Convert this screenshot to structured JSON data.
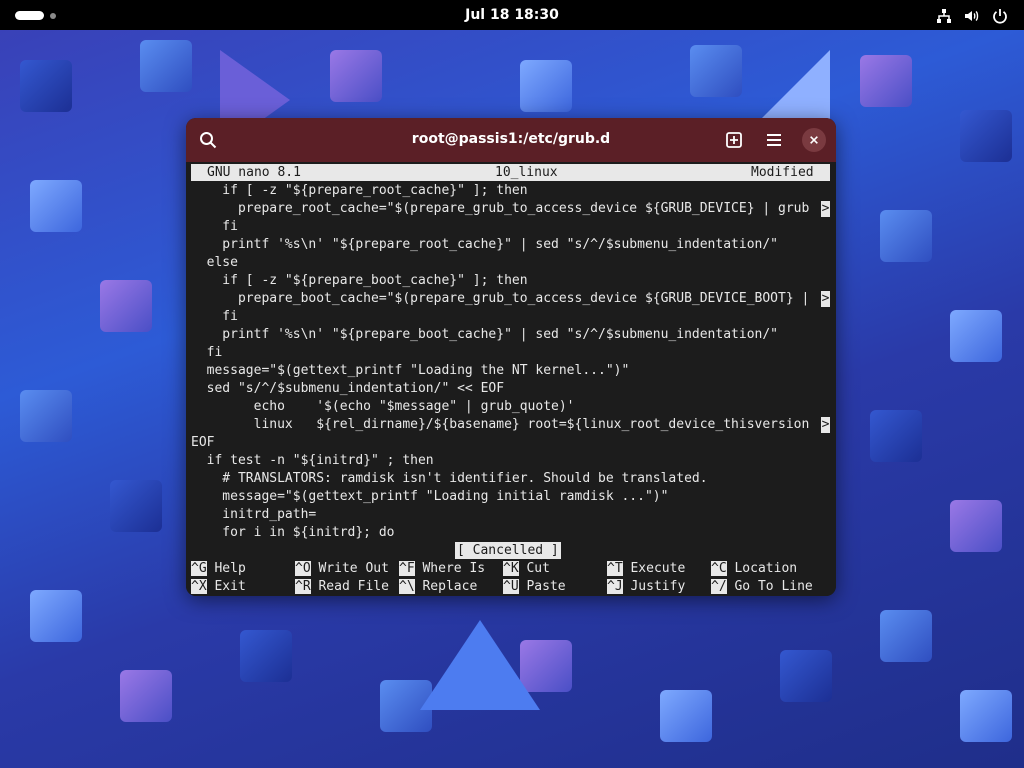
{
  "topbar": {
    "clock": "Jul 18  18:30",
    "icons": [
      "activities-pill",
      "network-icon",
      "volume-icon",
      "power-icon"
    ]
  },
  "window": {
    "title": "root@passis1:/etc/grub.d",
    "buttons": [
      "search-icon",
      "new-tab-icon",
      "menu-icon",
      "close-icon"
    ],
    "titlebar_color": "#5b1f26"
  },
  "nano": {
    "version": "GNU nano 8.1",
    "filename": "10_linux",
    "state": "Modified",
    "lines": [
      "    if [ -z \"${prepare_root_cache}\" ]; then",
      "      prepare_root_cache=\"$(prepare_grub_to_access_device ${GRUB_DEVICE} | grub",
      "    fi",
      "    printf '%s\\n' \"${prepare_root_cache}\" | sed \"s/^/$submenu_indentation/\"",
      "  else",
      "    if [ -z \"${prepare_boot_cache}\" ]; then",
      "      prepare_boot_cache=\"$(prepare_grub_to_access_device ${GRUB_DEVICE_BOOT} |",
      "    fi",
      "    printf '%s\\n' \"${prepare_boot_cache}\" | sed \"s/^/$submenu_indentation/\"",
      "  fi",
      "  message=\"$(gettext_printf \"Loading the NT kernel...\")\"",
      "  sed \"s/^/$submenu_indentation/\" << EOF",
      "        echo    '$(echo \"$message\" | grub_quote)'",
      "        linux   ${rel_dirname}/${basename} root=${linux_root_device_thisversion",
      "EOF",
      "  if test -n \"${initrd}\" ; then",
      "    # TRANSLATORS: ramdisk isn't identifier. Should be translated.",
      "    message=\"$(gettext_printf \"Loading initial ramdisk ...\")\"",
      "    initrd_path=",
      "    for i in ${initrd}; do"
    ],
    "overflow_marker": ">",
    "status": "[ Cancelled ]",
    "shortcuts": [
      {
        "key": "^G",
        "label": "Help"
      },
      {
        "key": "^O",
        "label": "Write Out"
      },
      {
        "key": "^F",
        "label": "Where Is"
      },
      {
        "key": "^K",
        "label": "Cut"
      },
      {
        "key": "^T",
        "label": "Execute"
      },
      {
        "key": "^C",
        "label": "Location"
      },
      {
        "key": "^X",
        "label": "Exit"
      },
      {
        "key": "^R",
        "label": "Read File"
      },
      {
        "key": "^\\",
        "label": "Replace"
      },
      {
        "key": "^U",
        "label": "Paste"
      },
      {
        "key": "^J",
        "label": "Justify"
      },
      {
        "key": "^/",
        "label": "Go To Line"
      }
    ]
  }
}
